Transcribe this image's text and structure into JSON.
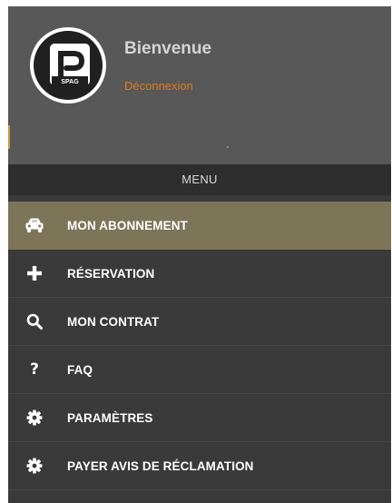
{
  "header": {
    "welcome": "Bienvenue",
    "logout": "Déconnexion",
    "logo_text": "SPAG"
  },
  "menu": {
    "title": "MENU",
    "items": [
      {
        "label": "MON ABONNEMENT",
        "icon": "car-icon",
        "active": true
      },
      {
        "label": "RÉSERVATION",
        "icon": "plus-icon",
        "active": false
      },
      {
        "label": "MON CONTRAT",
        "icon": "search-icon",
        "active": false
      },
      {
        "label": "FAQ",
        "icon": "question-icon",
        "active": false
      },
      {
        "label": "PARAMÈTRES",
        "icon": "gear-icon",
        "active": false
      },
      {
        "label": "PAYER AVIS DE RÉCLAMATION",
        "icon": "gear-icon",
        "active": false
      }
    ]
  },
  "colors": {
    "header_bg": "#585858",
    "drawer_bg": "#3a3a3a",
    "active_item_bg": "#7c7558",
    "logout_text": "#e07a1f",
    "accent_marker": "#c89a3c"
  }
}
